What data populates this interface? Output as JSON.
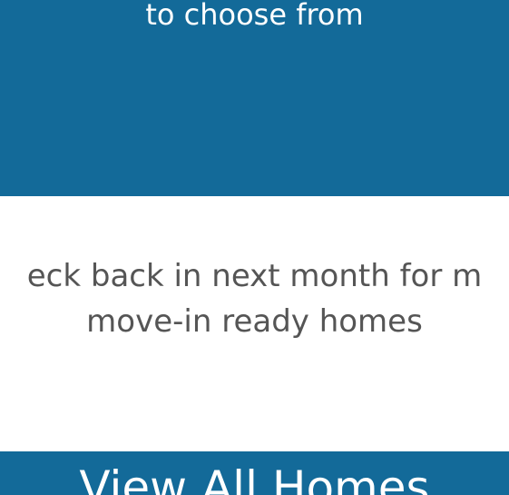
{
  "banner": {
    "text": "to choose from"
  },
  "message": {
    "line1": "eck back in next month for m",
    "line2": "move-in ready homes"
  },
  "cta": {
    "label": "View All Homes"
  },
  "colors": {
    "brand_blue": "#136a99",
    "body_text": "#555555",
    "background": "#ffffff"
  }
}
